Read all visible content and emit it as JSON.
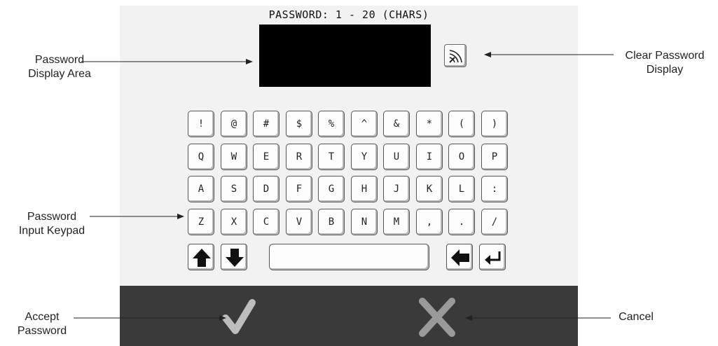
{
  "screen": {
    "title": "PASSWORD: 1 - 20 (CHARS)",
    "password_value": ""
  },
  "keypad": {
    "rows": [
      [
        "!",
        "@",
        "#",
        "$",
        "%",
        "^",
        "&",
        "*",
        "(",
        ")"
      ],
      [
        "Q",
        "W",
        "E",
        "R",
        "T",
        "Y",
        "U",
        "I",
        "O",
        "P"
      ],
      [
        "A",
        "S",
        "D",
        "F",
        "G",
        "H",
        "J",
        "K",
        "L",
        ":"
      ],
      [
        "Z",
        "X",
        "C",
        "V",
        "B",
        "N",
        "M",
        ",",
        ".",
        "/"
      ]
    ],
    "bottom_row": [
      "shift-up-icon",
      "shift-down-icon",
      "space-bar",
      "backspace-icon",
      "enter-icon"
    ]
  },
  "icons": {
    "clear": "clear-password-icon",
    "accept": "checkmark-icon",
    "cancel": "x-icon"
  },
  "callouts": {
    "display_area": [
      "Password",
      "Display Area"
    ],
    "keypad": [
      "Password",
      "Input Keypad"
    ],
    "accept": [
      "Accept",
      "Password"
    ],
    "clear": [
      "Clear Password",
      "Display"
    ],
    "cancel": "Cancel"
  },
  "colors": {
    "screen_bg": "#f2f2f2",
    "display_bg": "#000000",
    "bottom_bar": "#3a3a3a",
    "accept_icon": "#bdbdbd",
    "cancel_icon": "#9a9a9a"
  }
}
